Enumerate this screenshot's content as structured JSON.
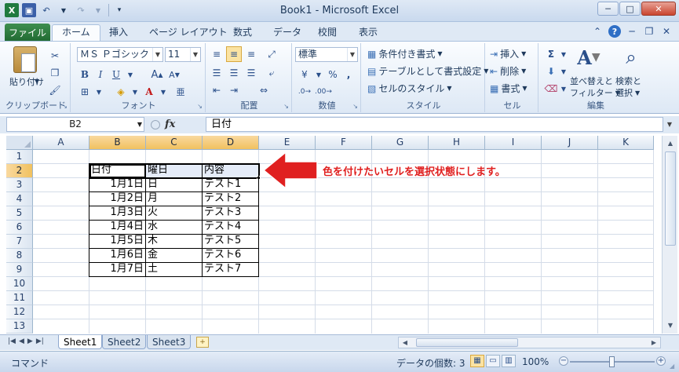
{
  "window": {
    "title": "Book1  -  Microsoft Excel",
    "qat": {
      "app_icon": "X",
      "save_icon": "save-icon",
      "undo_icon": "undo-icon",
      "redo_icon": "redo-icon"
    },
    "controls": {
      "minimize": "─",
      "maximize": "□",
      "close": "✕"
    }
  },
  "ribbon_tabs": {
    "file": "ファイル",
    "items": [
      "ホーム",
      "挿入",
      "ページ レイアウト",
      "数式",
      "データ",
      "校閲",
      "表示"
    ],
    "active": "ホーム"
  },
  "ribbon": {
    "clipboard": {
      "label": "クリップボード",
      "paste": "貼り付け"
    },
    "font": {
      "label": "フォント",
      "font_name": "ＭＳ Ｐゴシック",
      "font_size": "11"
    },
    "alignment": {
      "label": "配置"
    },
    "number": {
      "label": "数値",
      "format": "標準"
    },
    "styles": {
      "label": "スタイル",
      "conditional": "条件付き書式",
      "as_table": "テーブルとして書式設定",
      "cell_styles": "セルのスタイル"
    },
    "cells": {
      "label": "セル",
      "insert": "挿入",
      "delete": "削除",
      "format": "書式"
    },
    "editing": {
      "label": "編集",
      "sort_filter_1": "並べ替えと",
      "sort_filter_2": "フィルター",
      "find_1": "検索と",
      "find_2": "選択"
    }
  },
  "formula_bar": {
    "name_box": "B2",
    "fx": "fx",
    "content": "日付"
  },
  "grid": {
    "columns": [
      "A",
      "B",
      "C",
      "D",
      "E",
      "F",
      "G",
      "H",
      "I",
      "J",
      "K"
    ],
    "rows": [
      "1",
      "2",
      "3",
      "4",
      "5",
      "6",
      "7",
      "8",
      "9",
      "10",
      "11",
      "12",
      "13"
    ],
    "selected_columns": [
      "B",
      "C",
      "D"
    ],
    "selected_row": "2",
    "table": {
      "headers": [
        "日付",
        "曜日",
        "内容"
      ],
      "rows": [
        [
          "1月1日",
          "日",
          "テスト1"
        ],
        [
          "1月2日",
          "月",
          "テスト2"
        ],
        [
          "1月3日",
          "火",
          "テスト3"
        ],
        [
          "1月4日",
          "水",
          "テスト4"
        ],
        [
          "1月5日",
          "木",
          "テスト5"
        ],
        [
          "1月6日",
          "金",
          "テスト6"
        ],
        [
          "1月7日",
          "土",
          "テスト7"
        ]
      ]
    }
  },
  "annotation": {
    "text": "色を付けたいセルを選択状態にします。",
    "arrow_color": "#e02020"
  },
  "sheets": {
    "tabs": [
      "Sheet1",
      "Sheet2",
      "Sheet3"
    ],
    "active": "Sheet1"
  },
  "status": {
    "mode": "コマンド",
    "count": "データの個数: 3",
    "zoom": "100%"
  }
}
